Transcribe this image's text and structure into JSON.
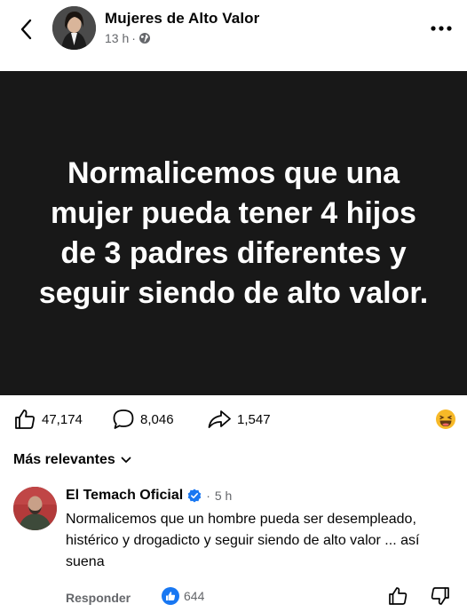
{
  "header": {
    "page_name": "Mujeres de Alto Valor",
    "time": "13 h",
    "separator": "·",
    "privacy_icon": "globe-icon"
  },
  "post": {
    "text": "Normalicemos que una mujer pueda tener 4 hijos de 3 padres diferentes y seguir siendo de alto valor."
  },
  "actions": {
    "likes": "47,174",
    "comments": "8,046",
    "shares": "1,547",
    "reaction_emoji": "laughing-emoji-icon"
  },
  "sort": {
    "label": "Más relevantes"
  },
  "comment": {
    "author": "El Temach Oficial",
    "verified_icon": "verified-badge-icon",
    "separator": "·",
    "time": "5 h",
    "text": "Normalicemos que un hombre pueda ser desempleado, histérico y drogadicto y seguir siendo de alto valor ... así suena",
    "reply_label": "Responder",
    "like_count": "644"
  },
  "colors": {
    "post_background": "#181818",
    "accent_blue": "#1877f2",
    "secondary_text": "#65676b"
  }
}
